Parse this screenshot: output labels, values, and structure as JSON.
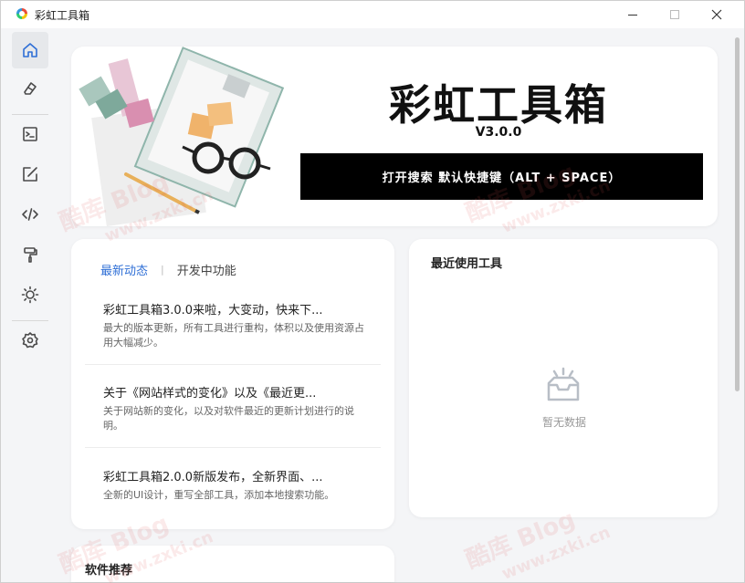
{
  "window": {
    "title": "彩虹工具箱"
  },
  "sidebar": {
    "items": [
      {
        "icon": "home-icon"
      },
      {
        "icon": "eraser-icon"
      },
      {
        "icon": "terminal-icon"
      },
      {
        "icon": "edit-icon"
      },
      {
        "icon": "code-icon"
      },
      {
        "icon": "paint-roller-icon"
      },
      {
        "icon": "sun-icon"
      },
      {
        "icon": "gear-icon"
      }
    ]
  },
  "hero": {
    "title": "彩虹工具箱",
    "version": "V3.0.0",
    "search_button": "打开搜索 默认快捷键（ALT + SPACE）"
  },
  "news": {
    "tabs": [
      "最新动态",
      "开发中功能"
    ],
    "items": [
      {
        "title": "彩虹工具箱3.0.0来啦，大变动，快来下...",
        "desc": "最大的版本更新，所有工具进行重构，体积以及使用资源占用大幅减少。"
      },
      {
        "title": "关于《网站样式的变化》以及《最近更...",
        "desc": "关于网站新的变化，以及对软件最近的更新计划进行的说明。"
      },
      {
        "title": "彩虹工具箱2.0.0新版发布，全新界面、...",
        "desc": "全新的UI设计，重写全部工具，添加本地搜索功能。"
      }
    ]
  },
  "recent": {
    "title": "最近使用工具",
    "empty_text": "暂无数据"
  },
  "recommend": {
    "title": "软件推荐"
  },
  "watermark": {
    "text1": "酷库 Blog",
    "text2": "www.zxki.cn"
  },
  "colors": {
    "accent": "#2f6fd6",
    "hero_button": "#000000"
  }
}
